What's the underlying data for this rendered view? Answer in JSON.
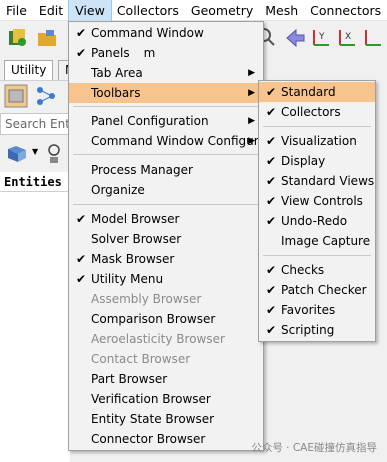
{
  "menubar": {
    "items": [
      "File",
      "Edit",
      "View",
      "Collectors",
      "Geometry",
      "Mesh",
      "Connectors",
      "M"
    ]
  },
  "left_panel": {
    "tabs": [
      "Utility",
      "M"
    ],
    "search_placeholder": "Search Entiti",
    "entities_header": "Entities"
  },
  "view_menu": {
    "items": [
      {
        "label": "Command Window",
        "checked": true
      },
      {
        "label": "Panels",
        "shortcut": "m",
        "checked": true
      },
      {
        "label": "Tab Area",
        "submenu": true
      },
      {
        "label": "Toolbars",
        "submenu": true,
        "highlight": true
      },
      {
        "label": "Panel Configuration",
        "submenu": true
      },
      {
        "label": "Command Window Configuration",
        "submenu": true
      },
      {
        "label": "Process Manager"
      },
      {
        "label": "Organize"
      },
      {
        "label": "Model Browser",
        "checked": true
      },
      {
        "label": "Solver Browser"
      },
      {
        "label": "Mask Browser",
        "checked": true
      },
      {
        "label": "Utility Menu",
        "checked": true
      },
      {
        "label": "Assembly Browser",
        "disabled": true
      },
      {
        "label": "Comparison Browser"
      },
      {
        "label": "Aeroelasticity Browser",
        "disabled": true
      },
      {
        "label": "Contact Browser",
        "disabled": true
      },
      {
        "label": "Part Browser"
      },
      {
        "label": "Verification Browser"
      },
      {
        "label": "Entity State Browser"
      },
      {
        "label": "Connector Browser"
      }
    ]
  },
  "toolbars_submenu": {
    "items": [
      {
        "label": "Standard",
        "checked": true,
        "highlight": true
      },
      {
        "label": "Collectors",
        "checked": true
      },
      {
        "label": "Visualization",
        "checked": true
      },
      {
        "label": "Display",
        "checked": true
      },
      {
        "label": "Standard Views",
        "checked": true
      },
      {
        "label": "View Controls",
        "checked": true
      },
      {
        "label": "Undo-Redo",
        "checked": true
      },
      {
        "label": "Image Capture"
      },
      {
        "label": "Checks",
        "checked": true
      },
      {
        "label": "Patch Checker",
        "checked": true
      },
      {
        "label": "Favorites",
        "checked": true
      },
      {
        "label": "Scripting",
        "checked": true
      }
    ]
  },
  "watermark": "公众号 · CAE碰撞仿真指导",
  "colors": {
    "highlight": "#f7c48e",
    "menubar_open": "#cde4f7"
  }
}
